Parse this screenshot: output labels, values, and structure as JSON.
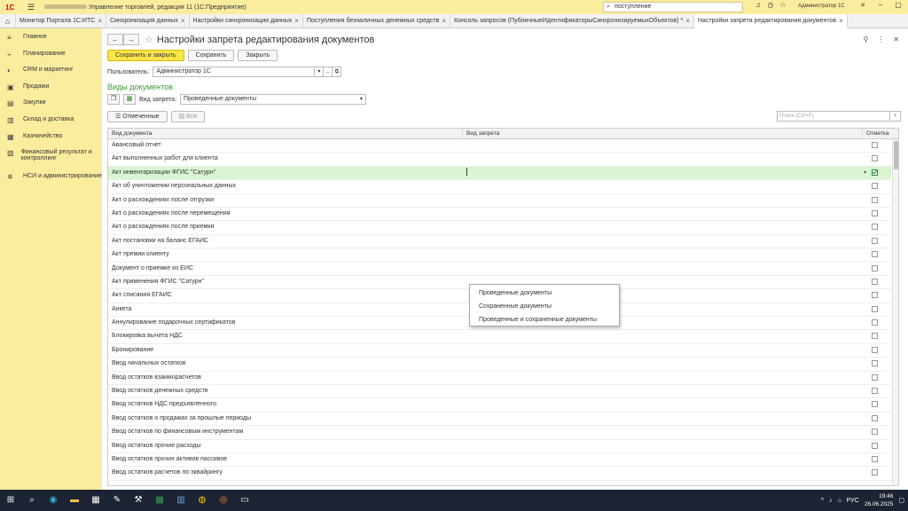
{
  "titlebar": {
    "logo": "1С",
    "menu_icon": "hamburger-icon",
    "title": "Управление торговлей, редакция 11  (1С:Предприятие)",
    "search_value": "поступление",
    "user": "Администратор 1С"
  },
  "tabs": [
    {
      "label": "Монитор Портала 1С:ИТС"
    },
    {
      "label": "Синхронизация данных"
    },
    {
      "label": "Настройки синхронизации данных"
    },
    {
      "label": "Поступления безналичных денежных средств"
    },
    {
      "label": "Консоль запросов (ПубличныеИдентификаторыСинхронизируемыхОбъектов) *"
    },
    {
      "label": "Настройки запрета редактирования документов"
    }
  ],
  "sidebar": {
    "items": [
      {
        "label": "Главное",
        "icon": "menu-icon"
      },
      {
        "label": "Планирование",
        "icon": "chart-icon"
      },
      {
        "label": "CRM и маркетинг",
        "icon": "crm-icon"
      },
      {
        "label": "Продажи",
        "icon": "briefcase-icon"
      },
      {
        "label": "Закупки",
        "icon": "cart-icon"
      },
      {
        "label": "Склад и доставка",
        "icon": "warehouse-icon"
      },
      {
        "label": "Казначейство",
        "icon": "treasury-icon"
      },
      {
        "label": "Финансовый результат и контроллинг",
        "icon": "finance-icon"
      },
      {
        "label": "НСИ и администрирование",
        "icon": "gear-icon"
      }
    ]
  },
  "form": {
    "title": "Настройки запрета редактирования документов",
    "save_close": "Сохранить и закрыть",
    "save": "Сохранить",
    "close": "Закрыть",
    "user_label": "Пользователь:",
    "user_value": "Администратор 1С",
    "section_title": "Виды документов",
    "ban_label": "Вид запрета:",
    "ban_value": "Проведенные документы",
    "marked_btn": "Отмеченные",
    "all_btn": "Все",
    "search_placeholder": "Поиск (Ctrl+F)"
  },
  "grid": {
    "headers": [
      "Вид документа",
      "Вид запрета",
      "Отметка"
    ],
    "rows": [
      {
        "name": "Авансовый отчет",
        "checked": false
      },
      {
        "name": "Акт выполненных работ для клиента",
        "checked": false
      },
      {
        "name": "Акт инвентаризации ФГИС \"Сатурн\"",
        "checked": true,
        "selected": true
      },
      {
        "name": "Акт об уничтожении персональных данных",
        "checked": false
      },
      {
        "name": "Акт о расхождениях после отгрузки",
        "checked": false
      },
      {
        "name": "Акт о расхождениях после перемещения",
        "checked": false
      },
      {
        "name": "Акт о расхождениях после приемки",
        "checked": false
      },
      {
        "name": "Акт постановки на баланс ЕГАИС",
        "checked": false
      },
      {
        "name": "Акт премии клиенту",
        "checked": false
      },
      {
        "name": "Документ о приемке из ЕИС",
        "checked": false
      },
      {
        "name": "Акт применения ФГИС \"Сатурн\"",
        "checked": false
      },
      {
        "name": "Акт списания ЕГАИС",
        "checked": false
      },
      {
        "name": "Анкета",
        "checked": false
      },
      {
        "name": "Аннулирование подарочных сертификатов",
        "checked": false
      },
      {
        "name": "Блокировка вычета НДС",
        "checked": false
      },
      {
        "name": "Бронирование",
        "checked": false
      },
      {
        "name": "Ввод начальных остатков",
        "checked": false
      },
      {
        "name": "Ввод остатков взаиморасчетов",
        "checked": false
      },
      {
        "name": "Ввод остатков денежных средств",
        "checked": false
      },
      {
        "name": "Ввод остатков НДС предъявленного",
        "checked": false
      },
      {
        "name": "Ввод остатков о продажах за прошлые периоды",
        "checked": false
      },
      {
        "name": "Ввод остатков по финансовым инструментам",
        "checked": false
      },
      {
        "name": "Ввод остатков прочие расходы",
        "checked": false
      },
      {
        "name": "Ввод остатков прочих активов пассивов",
        "checked": false
      },
      {
        "name": "Ввод остатков расчетов по эквайрингу",
        "checked": false
      }
    ]
  },
  "dropdown": {
    "options": [
      "Проведенные документы",
      "Сохраненные документы",
      "Проведенные и сохраненные документы"
    ]
  },
  "taskbar": {
    "lang": "РУС",
    "time": "19:46",
    "date": "26.06.2025"
  }
}
